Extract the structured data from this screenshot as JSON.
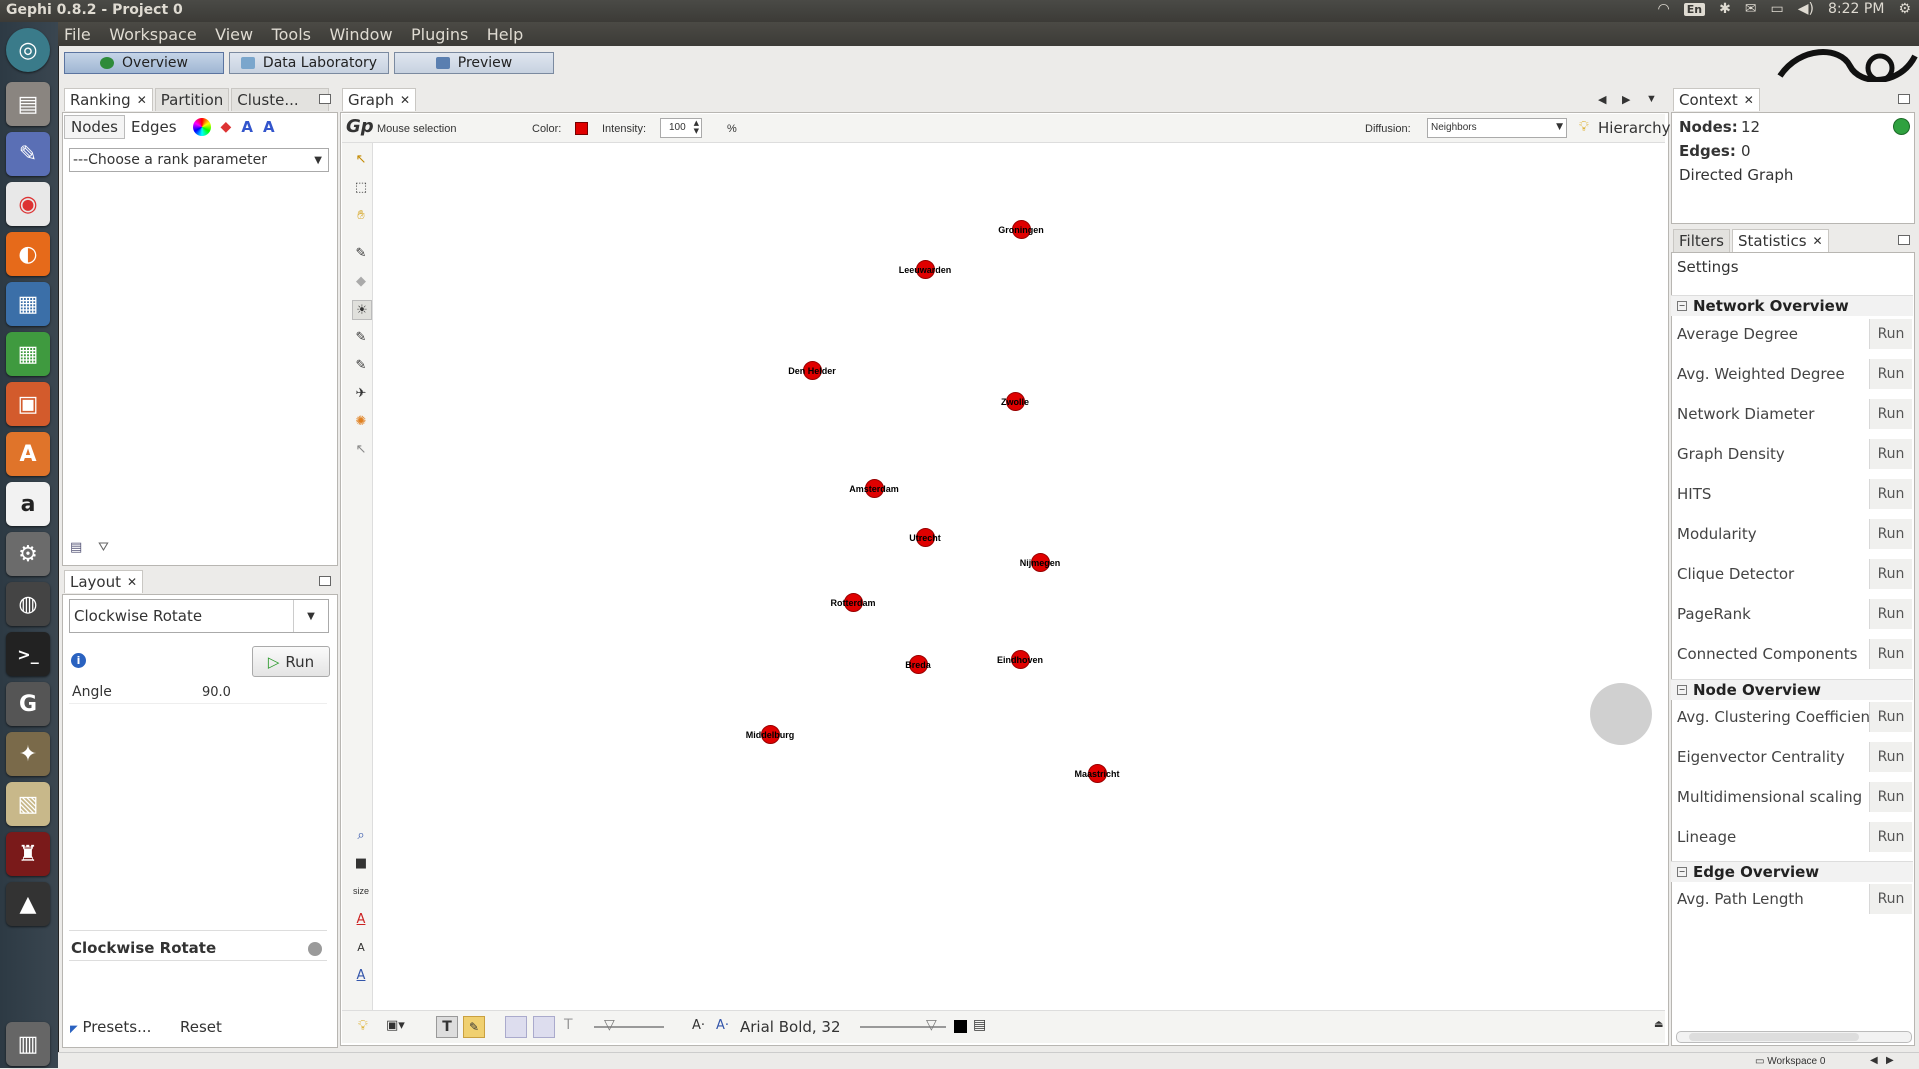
{
  "app": {
    "title": "Gephi 0.8.2 - Project 0"
  },
  "tray": {
    "lang": "En",
    "time": "8:22 PM"
  },
  "menu": [
    "File",
    "Workspace",
    "View",
    "Tools",
    "Window",
    "Plugins",
    "Help"
  ],
  "workspace_tabs": [
    "Overview",
    "Data Laboratory",
    "Preview"
  ],
  "ranking_panel": {
    "tabs": [
      "Ranking",
      "Partition",
      "Cluste..."
    ],
    "subtabs": [
      "Nodes",
      "Edges"
    ],
    "rank_select": "---Choose a rank parameter"
  },
  "layout_panel": {
    "tab": "Layout",
    "algorithm": "Clockwise Rotate",
    "run_label": "Run",
    "param_name": "Angle",
    "param_value": "90.0",
    "desc_title": "Clockwise Rotate",
    "presets": "Presets...",
    "reset": "Reset"
  },
  "graph_panel": {
    "tab": "Graph",
    "mouse_mode": "Mouse selection",
    "color_label": "Color:",
    "intensity_label": "Intensity:",
    "intensity_value": "100",
    "percent": "%",
    "diffusion_label": "Diffusion:",
    "diffusion_value": "Neighbors",
    "hierarchy": "Hierarchy",
    "font_label": "Arial Bold, 32",
    "size_label": "size"
  },
  "nodes": [
    {
      "label": "Groningen"
    },
    {
      "label": "Leeuwarden"
    },
    {
      "label": "Den Helder"
    },
    {
      "label": "Zwolle"
    },
    {
      "label": "Amsterdam"
    },
    {
      "label": "Utrecht"
    },
    {
      "label": "Nijmegen"
    },
    {
      "label": "Rotterdam"
    },
    {
      "label": "Breda"
    },
    {
      "label": "Eindhoven"
    },
    {
      "label": "Middelburg"
    },
    {
      "label": "Maastricht"
    }
  ],
  "context_panel": {
    "tab": "Context",
    "nodes_label": "Nodes:",
    "nodes_value": "12",
    "edges_label": "Edges:",
    "edges_value": "0",
    "graph_type": "Directed Graph"
  },
  "stats_panel": {
    "tabs": [
      "Filters",
      "Statistics"
    ],
    "settings": "Settings",
    "run": "Run",
    "sections": [
      {
        "title": "Network Overview",
        "items": [
          "Average Degree",
          "Avg. Weighted Degree",
          "Network Diameter",
          "Graph Density",
          "HITS",
          "Modularity",
          "Clique Detector",
          "PageRank",
          "Connected Components"
        ]
      },
      {
        "title": "Node Overview",
        "items": [
          "Avg. Clustering Coefficient",
          "Eigenvector Centrality",
          "Multidimensional scaling",
          "Lineage"
        ]
      },
      {
        "title": "Edge Overview",
        "items": [
          "Avg. Path Length"
        ]
      }
    ]
  },
  "status": {
    "workspace": "Workspace 0"
  },
  "colors": {
    "node": "#e00000",
    "accent": "#5b74a0"
  }
}
